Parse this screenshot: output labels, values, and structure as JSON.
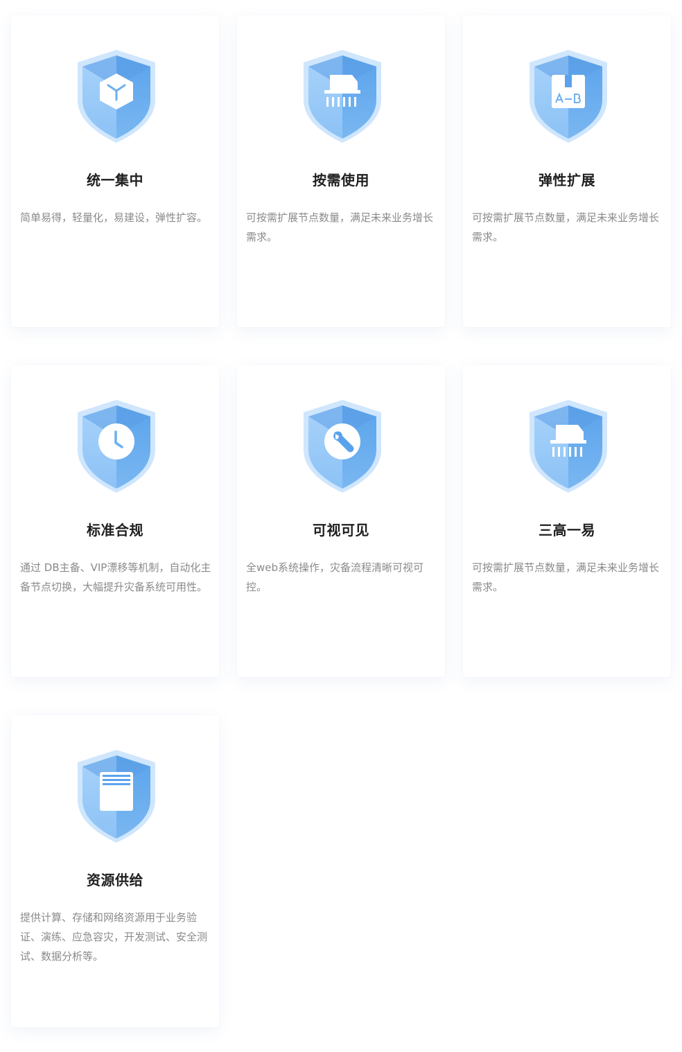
{
  "features": [
    {
      "title": "统一集中",
      "desc": "简单易得，轻量化，易建设，弹性扩容。",
      "icon": "cube-icon"
    },
    {
      "title": "按需使用",
      "desc": "可按需扩展节点数量，满足未来业务增长需求。",
      "icon": "shredder-icon"
    },
    {
      "title": "弹性扩展",
      "desc": "可按需扩展节点数量，满足未来业务增长需求。",
      "icon": "a-b-switch-icon"
    },
    {
      "title": "标准合规",
      "desc": "通过 DB主备、VIP漂移等机制，自动化主备节点切换，大幅提升灾备系统可用性。",
      "icon": "clock-icon"
    },
    {
      "title": "可视可见",
      "desc": "全web系统操作，灾备流程清晰可视可控。",
      "icon": "wrench-icon"
    },
    {
      "title": "三高一易",
      "desc": "可按需扩展节点数量，满足未来业务增长需求。",
      "icon": "shredder-icon"
    },
    {
      "title": "资源供给",
      "desc": "提供计算、存储和网络资源用于业务验证、演练、应急容灾，开发测试、安全测试、数据分析等。",
      "icon": "document-icon"
    }
  ],
  "colors": {
    "shield_light": "#a9d3fb",
    "shield_mid": "#7cb8f2",
    "shield_dark": "#4a98e8",
    "title": "#1f1f1f",
    "desc": "#8a8a8a"
  }
}
